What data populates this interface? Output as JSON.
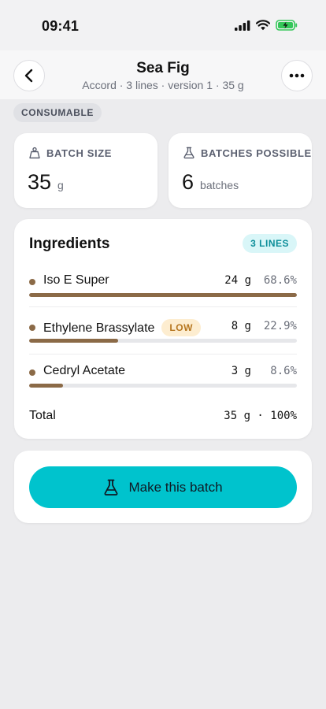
{
  "status_bar": {
    "time": "09:41"
  },
  "header": {
    "title": "Sea Fig",
    "subtitle": "Accord · 3 lines · version 1 · 35 g"
  },
  "badge": "CONSUMABLE",
  "stats": {
    "batch_size": {
      "label": "BATCH SIZE",
      "value": "35",
      "unit": "g"
    },
    "batches_possible": {
      "label": "BATCHES POSSIBLE",
      "value": "6",
      "unit": "batches"
    }
  },
  "ingredients": {
    "title": "Ingredients",
    "lines_badge": "3 LINES",
    "items": [
      {
        "name": "Iso E Super",
        "badge": "",
        "amount": "24 g",
        "percent": "68.6%",
        "fraction": 1.0
      },
      {
        "name": "Ethylene Brassylate",
        "badge": "LOW",
        "amount": "8 g",
        "percent": "22.9%",
        "fraction": 0.333
      },
      {
        "name": "Cedryl Acetate",
        "badge": "",
        "amount": "3 g",
        "percent": "8.6%",
        "fraction": 0.125
      }
    ],
    "total_label": "Total",
    "total_value": "35 g · 100%"
  },
  "action": {
    "make_label": "Make this batch"
  },
  "colors": {
    "accent": "#00c3cd",
    "ingredient": "#8b6a47",
    "low_badge_bg": "#fdedd0",
    "low_badge_text": "#b6761f",
    "lines_badge_bg": "#d9f6f8",
    "lines_badge_text": "#0b8d99"
  },
  "icons": {
    "back": "chevron-left-icon",
    "more": "more-horizontal-icon",
    "batch_size": "weight-icon",
    "batches_possible": "flask-icon",
    "make": "flask-icon"
  }
}
